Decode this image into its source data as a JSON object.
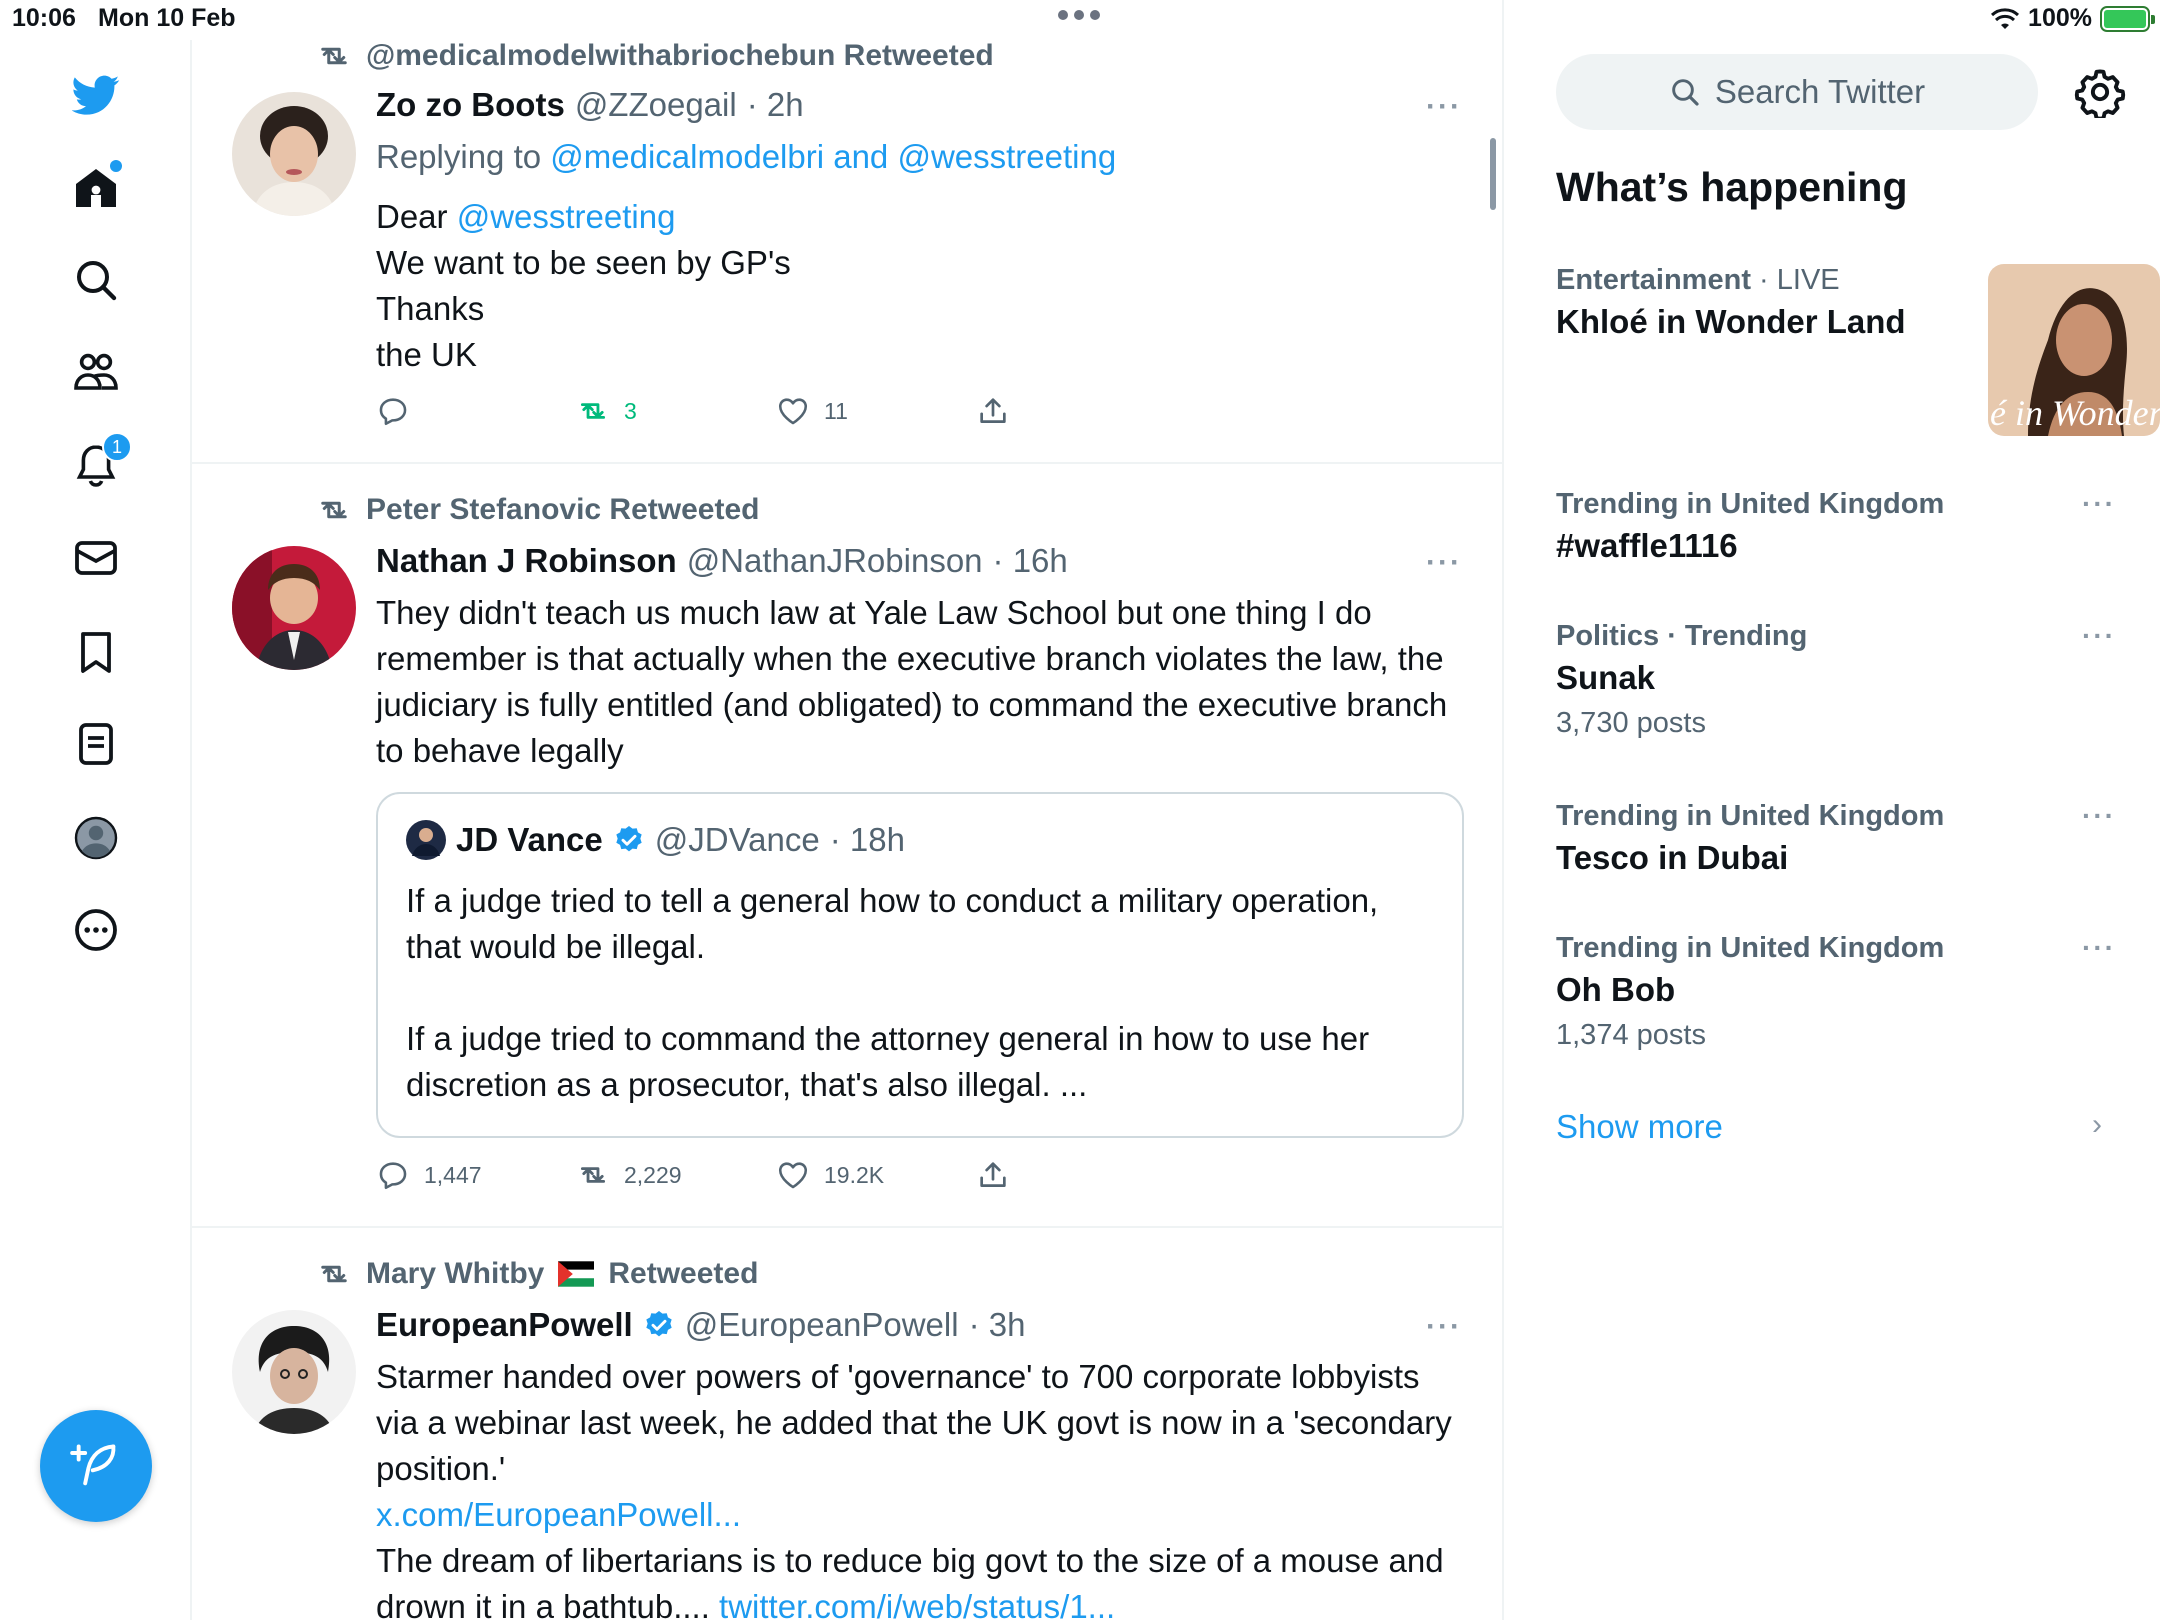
{
  "status_bar": {
    "time": "10:06",
    "date": "Mon 10 Feb",
    "battery": "100%"
  },
  "nav": {
    "notifications_count": "1"
  },
  "tweets": [
    {
      "retweeted_by": "@medicalmodelwithabriochebun Retweeted",
      "name": "Zo zo Boots",
      "handle": "@ZZoegail",
      "time": "· 2h",
      "replying_prefix": "Replying to",
      "replying_to": "@medicalmodelbri and @wesstreeting",
      "body_lines": [
        "Dear",
        "@wesstreeting",
        "We want to be seen by GP's",
        "Thanks",
        "the UK"
      ],
      "replies": "",
      "retweets": "3",
      "likes": "11"
    },
    {
      "retweeted_by": "Peter Stefanovic Retweeted",
      "name": "Nathan J Robinson",
      "handle": "@NathanJRobinson",
      "time": "· 16h",
      "body": "They didn't teach us much law at Yale Law School but one thing I do remember is that actually when the executive branch violates the law, the judiciary is fully entitled (and obligated) to command the executive branch to behave legally",
      "quote": {
        "name": "JD Vance",
        "handle": "@JDVance",
        "time": "· 18h",
        "para1": "If a judge tried to tell a general how to conduct a military operation, that would be illegal.",
        "para2": "If a judge tried to command the attorney general in how to use her discretion as a prosecutor, that's also illegal. ..."
      },
      "replies": "1,447",
      "retweets": "2,229",
      "likes": "19.2K"
    },
    {
      "retweeted_by_name": "Mary Whitby",
      "retweeted_suffix": "Retweeted",
      "name": "EuropeanPowell",
      "handle": "@EuropeanPowell",
      "time": "· 3h",
      "body1": "Starmer handed over powers of 'governance' to 700 corporate lobbyists via a webinar last week, he added that the UK govt is now in a 'secondary position.'",
      "link1": "x.com/EuropeanPowell...",
      "body2": "The dream of libertarians is to reduce big govt to the size of a mouse and drown it in a bathtub.... ",
      "link2": "twitter.com/i/web/status/1..."
    }
  ],
  "right": {
    "search_placeholder": "Search Twitter",
    "whats_happening": "What’s happening",
    "trends": [
      {
        "category": "Entertainment",
        "live": "· LIVE",
        "title": "Khloé in Wonder Land",
        "image_caption": "é in Wonder l"
      },
      {
        "category": "Trending in United Kingdom",
        "title": "#waffle1116",
        "count": ""
      },
      {
        "category": "Politics · Trending",
        "title": "Sunak",
        "count": "3,730 posts"
      },
      {
        "category": "Trending in United Kingdom",
        "title": "Tesco in Dubai",
        "count": ""
      },
      {
        "category": "Trending in United Kingdom",
        "title": "Oh Bob",
        "count": "1,374 posts"
      }
    ],
    "show_more": "Show more"
  },
  "colors": {
    "accent": "#1d9bf0",
    "retweet_green": "#00ba7c",
    "muted": "#536471"
  }
}
